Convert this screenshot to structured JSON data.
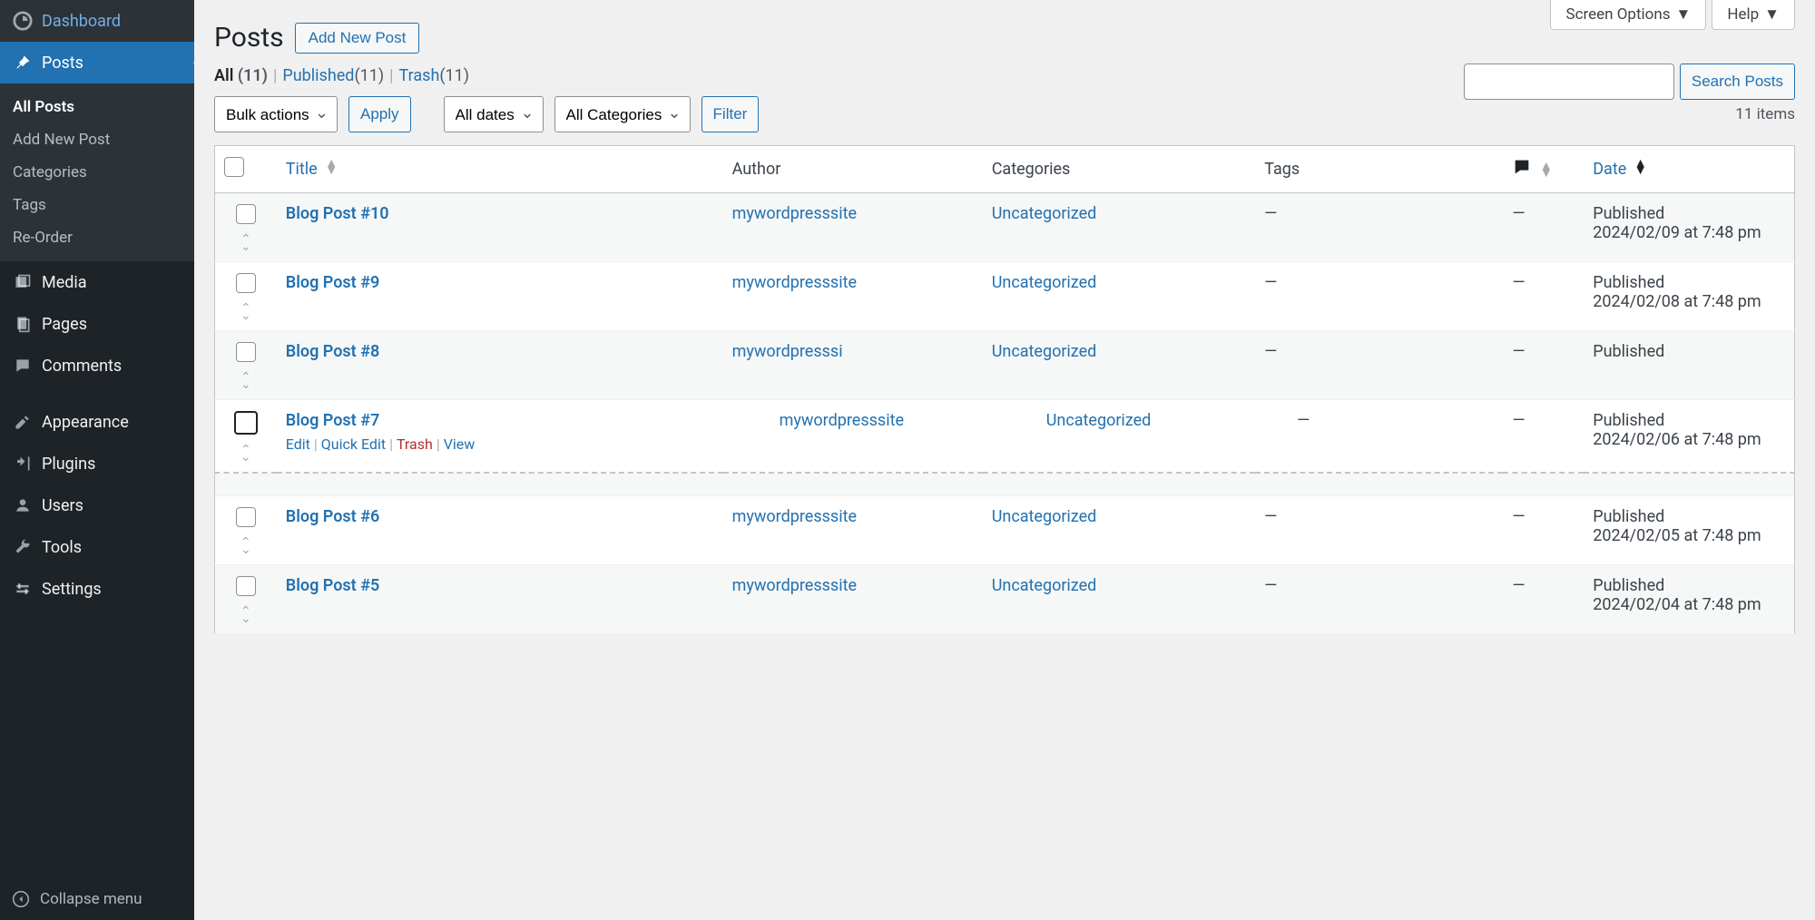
{
  "topTabs": {
    "screenOptions": "Screen Options",
    "help": "Help"
  },
  "sidebar": {
    "dashboard": "Dashboard",
    "posts": "Posts",
    "sub": {
      "allPosts": "All Posts",
      "addNewPost": "Add New Post",
      "categories": "Categories",
      "tags": "Tags",
      "reorder": "Re-Order"
    },
    "media": "Media",
    "pages": "Pages",
    "comments": "Comments",
    "appearance": "Appearance",
    "plugins": "Plugins",
    "users": "Users",
    "tools": "Tools",
    "settings": "Settings",
    "collapse": "Collapse menu"
  },
  "page": {
    "title": "Posts",
    "addNew": "Add New Post"
  },
  "filters": {
    "all": "All",
    "allCount": "(11)",
    "published": "Published",
    "publishedCount": "(11)",
    "trash": "Trash",
    "trashCount": "(11)"
  },
  "search": {
    "button": "Search Posts"
  },
  "bulk": {
    "bulkActions": "Bulk actions",
    "apply": "Apply",
    "allDates": "All dates",
    "allCategories": "All Categories",
    "filter": "Filter"
  },
  "itemCount": "11 items",
  "columns": {
    "title": "Title",
    "author": "Author",
    "categories": "Categories",
    "tags": "Tags",
    "date": "Date"
  },
  "rowActions": {
    "edit": "Edit",
    "quickEdit": "Quick Edit",
    "trash": "Trash",
    "view": "View"
  },
  "posts": [
    {
      "title": "Blog Post #10",
      "author": "mywordpresssite",
      "category": "Uncategorized",
      "tags": "—",
      "comments": "—",
      "dateStatus": "Published",
      "dateLine": "2024/02/09 at 7:48 pm"
    },
    {
      "title": "Blog Post #9",
      "author": "mywordpresssite",
      "category": "Uncategorized",
      "tags": "—",
      "comments": "—",
      "dateStatus": "Published",
      "dateLine": "2024/02/08 at 7:48 pm"
    },
    {
      "title": "Blog Post #8",
      "author": "mywordpresssi",
      "category": "Uncategorized",
      "tags": "—",
      "comments": "—",
      "dateStatus": "Published",
      "dateLine": ""
    },
    {
      "title": "Blog Post #7",
      "author": "mywordpresssite",
      "category": "Uncategorized",
      "tags": "—",
      "comments": "—",
      "dateStatus": "Published",
      "dateLine": "2024/02/06 at 7:48 pm",
      "hover": true,
      "indented": true
    },
    {
      "title": "Blog Post #6",
      "author": "mywordpresssite",
      "category": "Uncategorized",
      "tags": "—",
      "comments": "—",
      "dateStatus": "Published",
      "dateLine": "2024/02/05 at 7:48 pm"
    },
    {
      "title": "Blog Post #5",
      "author": "mywordpresssite",
      "category": "Uncategorized",
      "tags": "—",
      "comments": "—",
      "dateStatus": "Published",
      "dateLine": "2024/02/04 at 7:48 pm"
    }
  ]
}
